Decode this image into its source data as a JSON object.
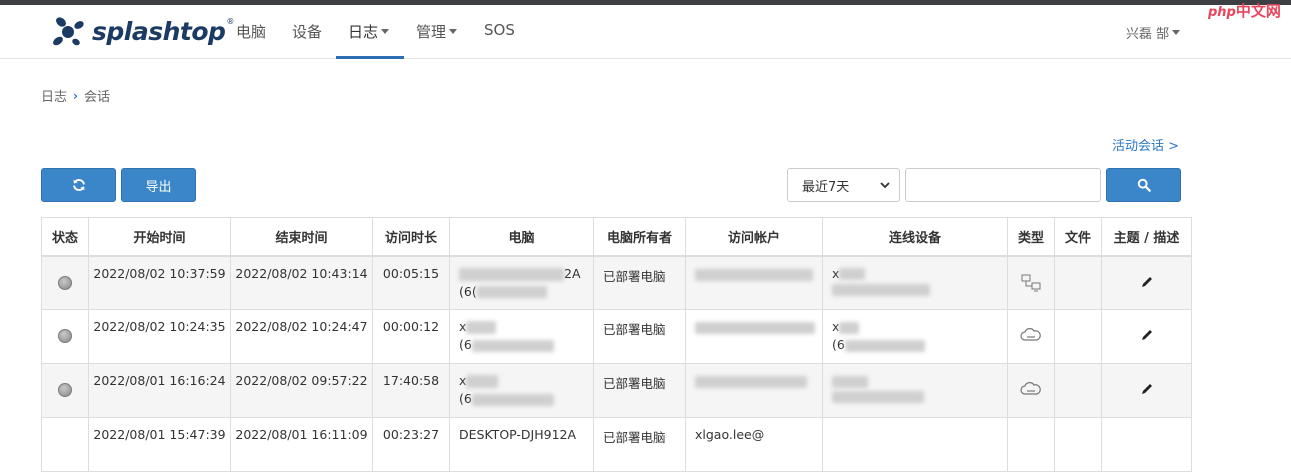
{
  "brand": {
    "name": "splashtop",
    "reg": "®"
  },
  "nav": {
    "items": [
      {
        "label": "电脑"
      },
      {
        "label": "设备"
      },
      {
        "label": "日志"
      },
      {
        "label": "管理"
      },
      {
        "label": "SOS"
      }
    ],
    "user": "兴磊 郜"
  },
  "watermark": {
    "prefix": "php",
    "text": "中文网"
  },
  "breadcrumb": {
    "parent": "日志",
    "current": "会话"
  },
  "active_sessions_link": "活动会话 >",
  "toolbar": {
    "refresh_icon": "refresh-icon",
    "export_label": "导出",
    "date_range": "最近7天",
    "search_value": "",
    "search_icon": "search-icon"
  },
  "colors": {
    "accent": "#3a86c8",
    "link": "#2b78c5",
    "brand": "#1b3a64"
  },
  "table": {
    "headers": [
      "状态",
      "开始时间",
      "结束时间",
      "访问时长",
      "电脑",
      "电脑所有者",
      "访问帐户",
      "连线设备",
      "类型",
      "文件",
      "主题 / 描述"
    ],
    "rows": [
      {
        "start": "2022/08/02 10:37:59",
        "end": "2022/08/02 10:43:14",
        "duration": "00:05:15",
        "computer_1": "2A",
        "computer_2": "(6(",
        "owner": "已部署电脑",
        "device_1": "x",
        "device_2": "",
        "type_icon": "lan-computer-icon"
      },
      {
        "start": "2022/08/02 10:24:35",
        "end": "2022/08/02 10:24:47",
        "duration": "00:00:12",
        "computer_1": "x",
        "computer_2": "(6",
        "owner": "已部署电脑",
        "device_1": "x",
        "device_2": "(6",
        "type_icon": "cloud-link-icon"
      },
      {
        "start": "2022/08/01 16:16:24",
        "end": "2022/08/02 09:57:22",
        "duration": "17:40:58",
        "computer_1": "x",
        "computer_2": "(6",
        "owner": "已部署电脑",
        "device_1": "",
        "device_2": "",
        "type_icon": "cloud-link-icon"
      }
    ],
    "partial_row": {
      "start": "2022/08/01 15:47:39",
      "end": "2022/08/01 16:11:09",
      "duration": "00:23:27",
      "computer": "DESKTOP-DJH912A",
      "owner": "已部署电脑",
      "account": "xlgao.lee@"
    }
  }
}
